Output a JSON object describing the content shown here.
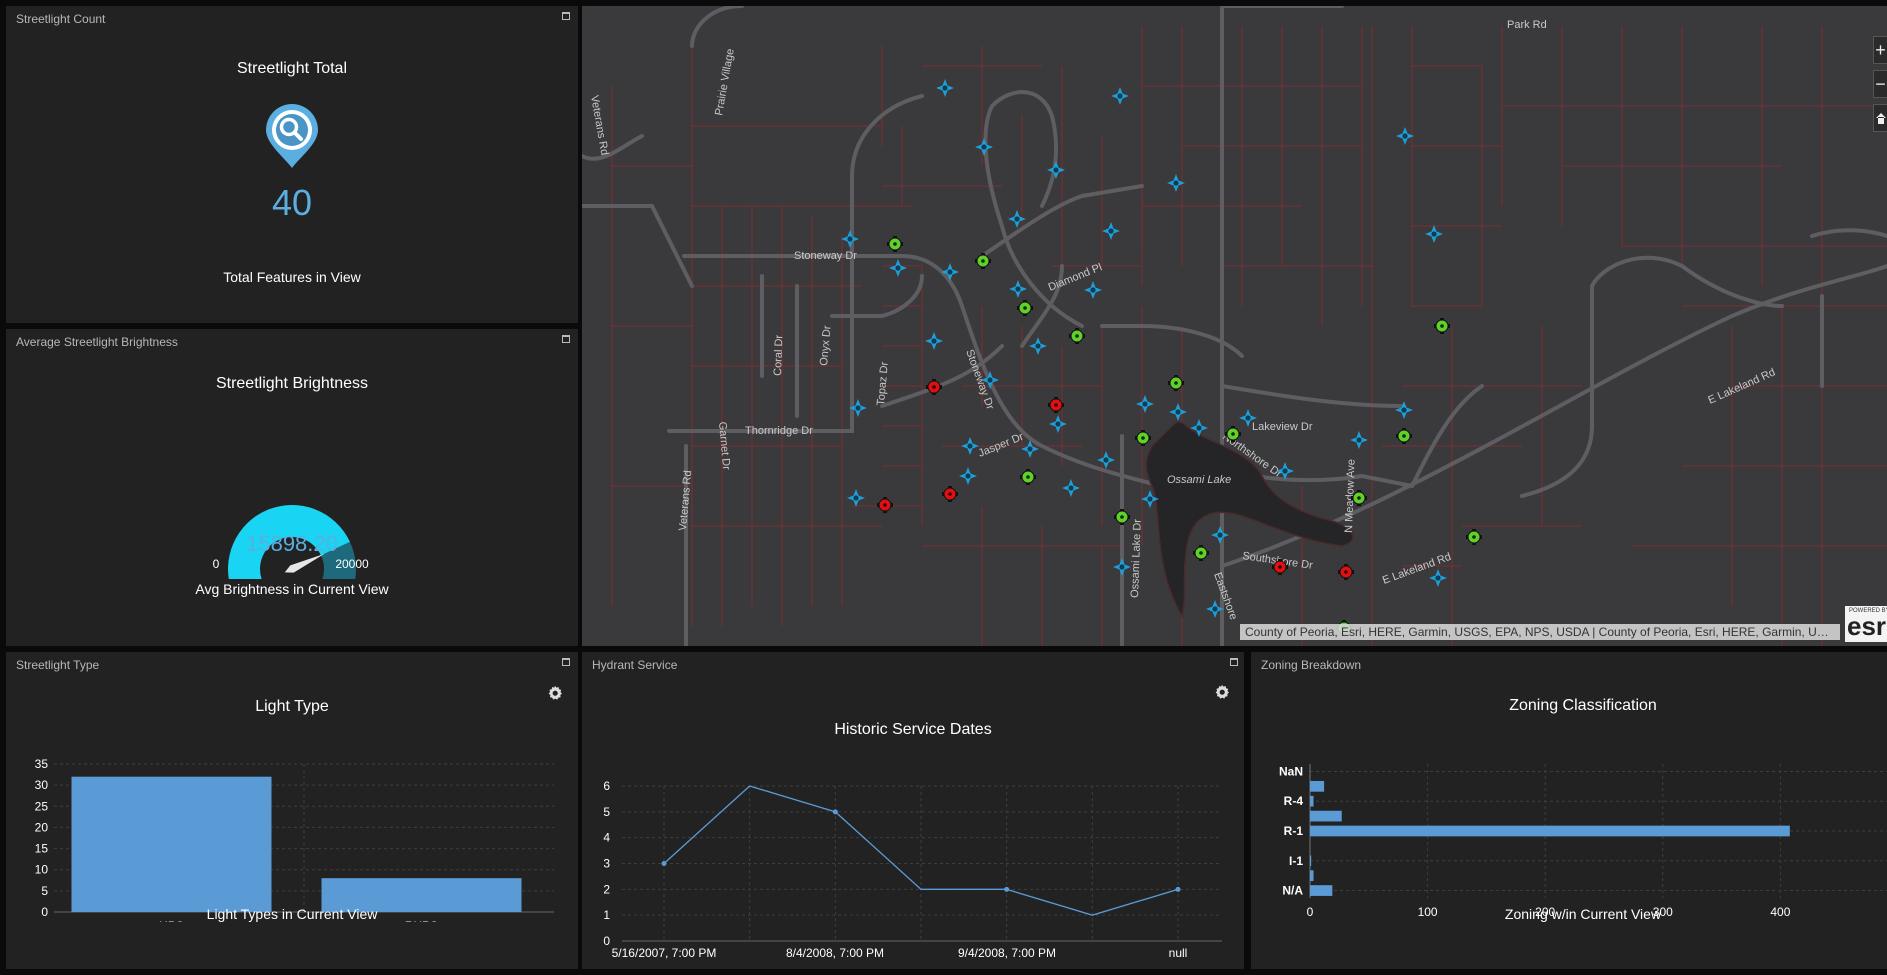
{
  "count_panel": {
    "title": "Streetlight Count",
    "heading": "Streetlight Total",
    "value": "40",
    "subtitle": "Total Features in View",
    "icon": "location-search-icon",
    "accent": "#5aaee0"
  },
  "brightness_panel": {
    "title": "Average Streetlight Brightness",
    "heading": "Streetlight Brightness",
    "gauge": {
      "min": 0,
      "max": 20000,
      "value": 15898.2,
      "min_label": "0",
      "max_label": "20000",
      "value_label": "15898.20"
    },
    "subtitle": "Avg Brightness in Current View",
    "colors": {
      "fill": "#1ad4f3",
      "remaining": "#1e6a7c",
      "value_text": "#5aaee0"
    }
  },
  "map": {
    "attribution": "County of Peoria, Esri, HERE, Garmin, USGS, EPA, NPS, USDA | County of Peoria, Esri, HERE, Garmin, USGS, EPA, NPS, USDA",
    "logo_powered": "POWERED BY",
    "logo_text": "esri",
    "zoom_in": "+",
    "zoom_out": "−",
    "home_icon": "home-icon",
    "streets": {
      "park_rd": "Park Rd",
      "prairie_village": "Prairie Village",
      "veterans_rd_n": "Veterans Rd",
      "veterans_rd_s": "Veterans Rd",
      "stoneway_dr": "Stoneway Dr",
      "stoneway_dr_2": "Stoneway Dr",
      "diamond_pl": "Diamond Pl",
      "coral_dr": "Coral Dr",
      "onyx_dr": "Onyx Dr",
      "topaz_dr": "Topaz Dr",
      "garnet_dr": "Garnet Dr",
      "thornridge_dr": "Thornridge Dr",
      "jasper_dr": "Jasper Dr",
      "lakeview_dr": "Lakeview Dr",
      "northshore_dr": "Northshore Dr",
      "ossami_lake": "Ossami Lake",
      "ossami_lake_dr": "Ossami Lake Dr",
      "southshore_dr": "Southshore Dr",
      "eastshore": "Eastshore",
      "n_meadow_ave": "N Meadow Ave",
      "e_lakeland_rd": "E Lakeland Rd",
      "e_lakeland_rd_2": "E Lakeland Rd"
    },
    "colors": {
      "background": "#3a3a3c",
      "parcel": "#6e3134",
      "road": "#5a5a5e",
      "lake": "#252527",
      "blue": "#1f9fd8",
      "green": "#5fd12a",
      "red": "#e01010"
    }
  },
  "type_panel": {
    "title": "Streetlight Type",
    "settings_icon": "gear-icon",
    "subtitle": "Light Types in Current View",
    "chart_data": {
      "type": "bar",
      "title": "Light Type",
      "categories": [
        "HPS",
        "RHPS"
      ],
      "values": [
        32,
        8
      ],
      "ylim": [
        0,
        35
      ],
      "yticks": [
        0,
        5,
        10,
        15,
        20,
        25,
        30,
        35
      ],
      "grid": true,
      "color": "#5b9bd5"
    }
  },
  "hydrant_panel": {
    "title": "Hydrant Service",
    "settings_icon": "gear-icon",
    "chart_data": {
      "type": "line",
      "title": "Historic Service Dates",
      "x_tick_labels": [
        "5/16/2007, 7:00 PM",
        "8/4/2008, 7:00 PM",
        "9/4/2008, 7:00 PM",
        "null"
      ],
      "values": [
        3,
        6,
        5,
        2,
        2,
        1,
        2
      ],
      "marked_points": [
        true,
        false,
        true,
        false,
        true,
        false,
        true
      ],
      "ylim": [
        0,
        6
      ],
      "yticks": [
        0,
        1,
        2,
        3,
        4,
        5,
        6
      ],
      "grid": true,
      "color": "#5b9bd5"
    }
  },
  "zoning_panel": {
    "title": "Zoning Breakdown",
    "subtitle": "Zoning w/in Current View",
    "chart_data": {
      "type": "bar",
      "orientation": "horizontal",
      "title": "Zoning Classification",
      "category_labels": [
        "NaN",
        "",
        "R-4",
        "",
        "R-1",
        "",
        "I-1",
        "",
        "N/A"
      ],
      "values": [
        0,
        12,
        3,
        27,
        408,
        0,
        1,
        3,
        19
      ],
      "xlim": [
        0,
        450
      ],
      "xticks": [
        0,
        100,
        200,
        300,
        400
      ],
      "grid": true,
      "color": "#5b9bd5"
    }
  }
}
